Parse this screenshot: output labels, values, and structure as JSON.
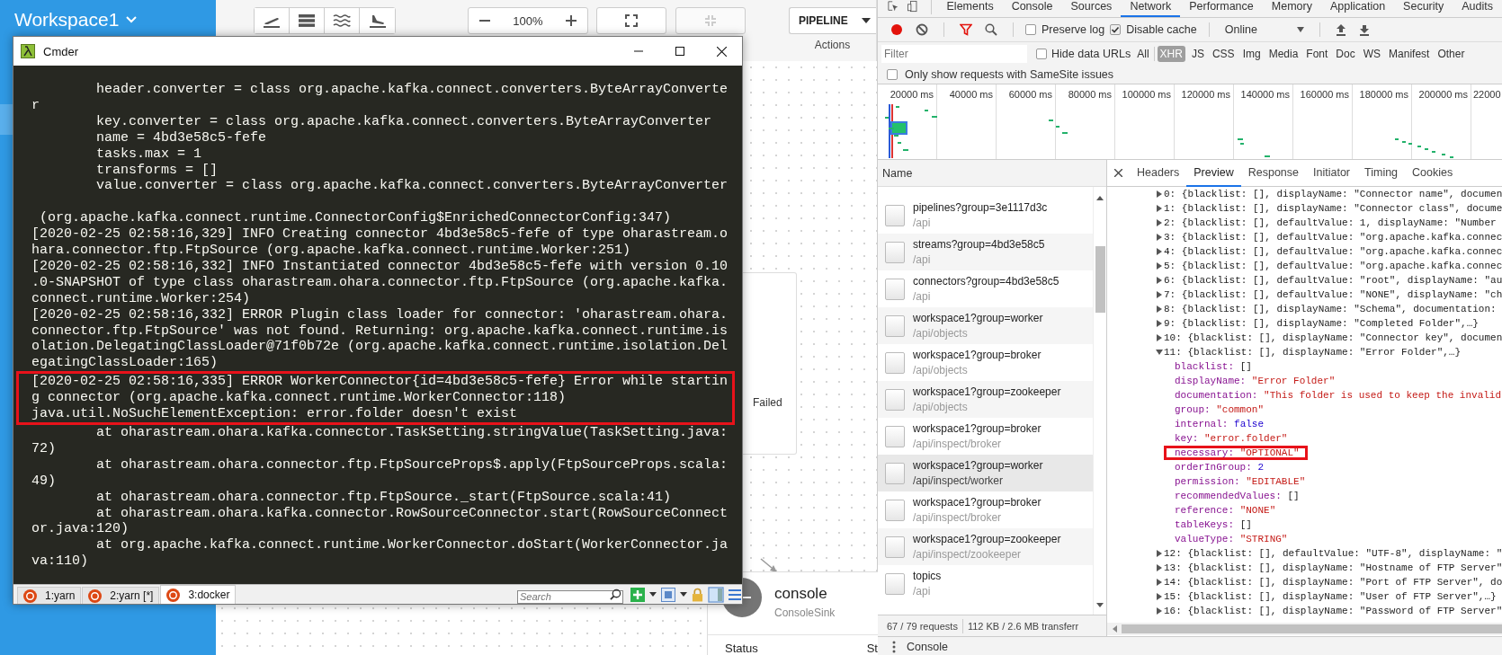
{
  "app": {
    "workspace": "Workspace1",
    "zoom": "100%",
    "view_buttons": [
      {
        "disabled": false
      },
      {
        "disabled": true
      }
    ],
    "pipeline_menu": "PIPELINE",
    "actions_label": "Actions",
    "status_node": {
      "status": "Failed"
    },
    "console_node": {
      "name": "console",
      "type": "ConsoleSink",
      "fields": [
        "Status",
        "St"
      ]
    }
  },
  "cmder": {
    "title": "Cmder",
    "blocks": [
      {
        "boxed": false,
        "spaced": false,
        "lines": [
          "        header.converter = class org.apache.kafka.connect.converters.ByteArrayConverte",
          "r",
          "        key.converter = class org.apache.kafka.connect.converters.ByteArrayConverter",
          "        name = 4bd3e58c5-fefe",
          "        tasks.max = 1",
          "        transforms = []",
          "        value.converter = class org.apache.kafka.connect.converters.ByteArrayConverter"
        ]
      },
      {
        "boxed": false,
        "spaced": true,
        "lines": [
          " (org.apache.kafka.connect.runtime.ConnectorConfig$EnrichedConnectorConfig:347)",
          "[2020-02-25 02:58:16,329] INFO Creating connector 4bd3e58c5-fefe of type oharastream.o",
          "hara.connector.ftp.FtpSource (org.apache.kafka.connect.runtime.Worker:251)",
          "[2020-02-25 02:58:16,332] INFO Instantiated connector 4bd3e58c5-fefe with version 0.10",
          ".0-SNAPSHOT of type class oharastream.ohara.connector.ftp.FtpSource (org.apache.kafka.",
          "connect.runtime.Worker:254)",
          "[2020-02-25 02:58:16,332] ERROR Plugin class loader for connector: 'oharastream.ohara.",
          "connector.ftp.FtpSource' was not found. Returning: org.apache.kafka.connect.runtime.is",
          "olation.DelegatingClassLoader@71f0b72e (org.apache.kafka.connect.runtime.isolation.Del",
          "egatingClassLoader:165)"
        ]
      },
      {
        "boxed": true,
        "spaced": false,
        "lines": [
          "[2020-02-25 02:58:16,335] ERROR WorkerConnector{id=4bd3e58c5-fefe} Error while startin",
          "g connector (org.apache.kafka.connect.runtime.WorkerConnector:118)",
          "java.util.NoSuchElementException: error.folder doesn't exist"
        ]
      },
      {
        "boxed": false,
        "spaced": false,
        "lines": [
          "        at oharastream.ohara.kafka.connector.TaskSetting.stringValue(TaskSetting.java:",
          "72)",
          "        at oharastream.ohara.connector.ftp.FtpSourceProps$.apply(FtpSourceProps.scala:",
          "49)",
          "        at oharastream.ohara.connector.ftp.FtpSource._start(FtpSource.scala:41)",
          "        at oharastream.ohara.kafka.connector.RowSourceConnector.start(RowSourceConnect",
          "or.java:120)",
          "        at org.apache.kafka.connect.runtime.WorkerConnector.doStart(WorkerConnector.ja",
          "va:110)"
        ]
      }
    ],
    "tabs": [
      {
        "label": "1:yarn",
        "selected": false
      },
      {
        "label": "2:yarn [*]",
        "selected": false
      },
      {
        "label": "3:docker",
        "selected": true
      }
    ],
    "search": {
      "placeholder": "Search"
    }
  },
  "devtools": {
    "tabs": [
      {
        "label": "Elements",
        "selected": false
      },
      {
        "label": "Console",
        "selected": false
      },
      {
        "label": "Sources",
        "selected": false
      },
      {
        "label": "Network",
        "selected": true
      },
      {
        "label": "Performance",
        "selected": false
      },
      {
        "label": "Memory",
        "selected": false
      },
      {
        "label": "Application",
        "selected": false
      },
      {
        "label": "Security",
        "selected": false
      },
      {
        "label": "Audits",
        "selected": false
      }
    ],
    "recording": true,
    "preserve_log": {
      "label": "Preserve log",
      "checked": false
    },
    "disable_cache": {
      "label": "Disable cache",
      "checked": true
    },
    "throttling": "Online",
    "filter": {
      "placeholder": "Filter"
    },
    "hide_data_urls": {
      "label": "Hide data URLs",
      "checked": false
    },
    "type_filters": [
      {
        "label": "All",
        "selected": false
      },
      {
        "label": "XHR",
        "selected": true
      },
      {
        "label": "JS",
        "selected": false
      },
      {
        "label": "CSS",
        "selected": false
      },
      {
        "label": "Img",
        "selected": false
      },
      {
        "label": "Media",
        "selected": false
      },
      {
        "label": "Font",
        "selected": false
      },
      {
        "label": "Doc",
        "selected": false
      },
      {
        "label": "WS",
        "selected": false
      },
      {
        "label": "Manifest",
        "selected": false
      },
      {
        "label": "Other",
        "selected": false
      }
    ],
    "samesite": {
      "label": "Only show requests with SameSite issues",
      "checked": false
    },
    "timeline_labels": [
      "20000 ms",
      "40000 ms",
      "60000 ms",
      "80000 ms",
      "100000 ms",
      "120000 ms",
      "140000 ms",
      "160000 ms",
      "180000 ms",
      "200000 ms",
      "22000"
    ],
    "name_header": "Name",
    "requests": [
      {
        "name": "pipelines?group=3e1117d3c",
        "path": "/api",
        "selected": false
      },
      {
        "name": "streams?group=4bd3e58c5",
        "path": "/api",
        "selected": false
      },
      {
        "name": "connectors?group=4bd3e58c5",
        "path": "/api",
        "selected": false
      },
      {
        "name": "workspace1?group=worker",
        "path": "/api/objects",
        "selected": false
      },
      {
        "name": "workspace1?group=broker",
        "path": "/api/objects",
        "selected": false
      },
      {
        "name": "workspace1?group=zookeeper",
        "path": "/api/objects",
        "selected": false
      },
      {
        "name": "workspace1?group=broker",
        "path": "/api/inspect/broker",
        "selected": false
      },
      {
        "name": "workspace1?group=worker",
        "path": "/api/inspect/worker",
        "selected": true
      },
      {
        "name": "workspace1?group=broker",
        "path": "/api/inspect/broker",
        "selected": false
      },
      {
        "name": "workspace1?group=zookeeper",
        "path": "/api/inspect/zookeeper",
        "selected": false
      },
      {
        "name": "topics",
        "path": "/api",
        "selected": false
      }
    ],
    "status": [
      "67 / 79 requests",
      "112 KB / 2.6 MB transferr"
    ],
    "detail_tabs": [
      {
        "label": "Headers",
        "selected": false
      },
      {
        "label": "Preview",
        "selected": true
      },
      {
        "label": "Response",
        "selected": false
      },
      {
        "label": "Initiator",
        "selected": false
      },
      {
        "label": "Timing",
        "selected": false
      },
      {
        "label": "Cookies",
        "selected": false
      }
    ],
    "preview": [
      {
        "text": "0: {blacklist: [], displayName: \"Connector name\", documen",
        "expanded": false
      },
      {
        "text": "1: {blacklist: [], displayName: \"Connector class\", docume",
        "expanded": false
      },
      {
        "text": "2: {blacklist: [], defaultValue: 1, displayName: \"Number",
        "expanded": false
      },
      {
        "text": "3: {blacklist: [], defaultValue: \"org.apache.kafka.connec",
        "expanded": false
      },
      {
        "text": "4: {blacklist: [], defaultValue: \"org.apache.kafka.connec",
        "expanded": false
      },
      {
        "text": "5: {blacklist: [], defaultValue: \"org.apache.kafka.connec",
        "expanded": false
      },
      {
        "text": "6: {blacklist: [], defaultValue: \"root\", displayName: \"au",
        "expanded": false
      },
      {
        "text": "7: {blacklist: [], defaultValue: \"NONE\", displayName: \"ch",
        "expanded": false
      },
      {
        "text": "8: {blacklist: [], displayName: \"Schema\", documentation:",
        "expanded": false
      },
      {
        "text": "9: {blacklist: [], displayName: \"Completed Folder\",…}",
        "expanded": false
      },
      {
        "text": "10: {blacklist: [], displayName: \"Connector key\", documen",
        "expanded": false
      },
      {
        "text": "11: {blacklist: [], displayName: \"Error Folder\",…}",
        "expanded": true,
        "children": [
          {
            "key": "blacklist:",
            "value": "[]",
            "kind": "literal",
            "boxed": false
          },
          {
            "key": "displayName:",
            "value": "\"Error Folder\"",
            "kind": "string",
            "boxed": false
          },
          {
            "key": "documentation:",
            "value": "\"This folder is used to keep the invalid",
            "kind": "string",
            "boxed": false
          },
          {
            "key": "group:",
            "value": "\"common\"",
            "kind": "string",
            "boxed": false
          },
          {
            "key": "internal:",
            "value": "false",
            "kind": "number",
            "boxed": false
          },
          {
            "key": "key:",
            "value": "\"error.folder\"",
            "kind": "string",
            "boxed": false
          },
          {
            "key": "necessary:",
            "value": "\"OPTIONAL\"",
            "kind": "string",
            "boxed": true
          },
          {
            "key": "orderInGroup:",
            "value": "2",
            "kind": "number",
            "boxed": false
          },
          {
            "key": "permission:",
            "value": "\"EDITABLE\"",
            "kind": "string",
            "boxed": false
          },
          {
            "key": "recommendedValues:",
            "value": "[]",
            "kind": "literal",
            "boxed": false
          },
          {
            "key": "reference:",
            "value": "\"NONE\"",
            "kind": "string",
            "boxed": false
          },
          {
            "key": "tableKeys:",
            "value": "[]",
            "kind": "literal",
            "boxed": false
          },
          {
            "key": "valueType:",
            "value": "\"STRING\"",
            "kind": "string",
            "boxed": false
          }
        ]
      },
      {
        "text": "12: {blacklist: [], defaultValue: \"UTF-8\", displayName: \"",
        "expanded": false
      },
      {
        "text": "13: {blacklist: [], displayName: \"Hostname of FTP Server\"",
        "expanded": false
      },
      {
        "text": "14: {blacklist: [], displayName: \"Port of FTP Server\", do",
        "expanded": false
      },
      {
        "text": "15: {blacklist: [], displayName: \"User of FTP Server\",…}",
        "expanded": false
      },
      {
        "text": "16: {blacklist: [], displayName: \"Password of FTP Server\"",
        "expanded": false
      }
    ],
    "drawer_tab": "Console"
  }
}
